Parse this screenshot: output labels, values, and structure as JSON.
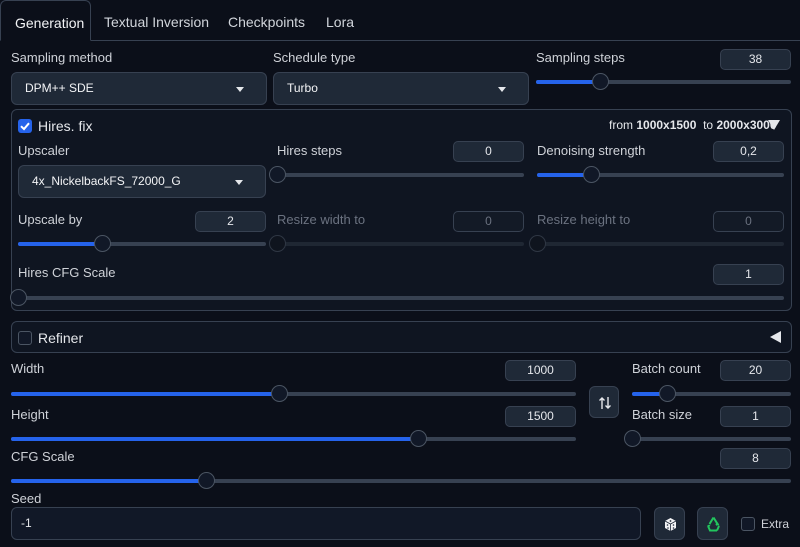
{
  "tabs": [
    "Generation",
    "Textual Inversion",
    "Checkpoints",
    "Lora"
  ],
  "sampling": {
    "method_label": "Sampling method",
    "method_value": "DPM++ SDE",
    "schedule_label": "Schedule type",
    "schedule_value": "Turbo",
    "steps_label": "Sampling steps",
    "steps_value": "38",
    "steps_fraction": 0.25
  },
  "hires": {
    "title": "Hires. fix",
    "enabled": true,
    "res_from_prefix": "from",
    "res_from": "1000x1500",
    "res_to_prefix": "to",
    "res_to": "2000x3000",
    "upscaler_label": "Upscaler",
    "upscaler_value": "4x_NickelbackFS_72000_G",
    "steps_label": "Hires steps",
    "steps_value": "0",
    "steps_fraction": 0.0,
    "denoise_label": "Denoising strength",
    "denoise_value": "0,2",
    "denoise_fraction": 0.22,
    "upscale_by_label": "Upscale by",
    "upscale_by_value": "2",
    "upscale_by_fraction": 0.34,
    "resize_w_label": "Resize width to",
    "resize_w_value": "0",
    "resize_w_fraction": 0.0,
    "resize_h_label": "Resize height to",
    "resize_h_value": "0",
    "resize_h_fraction": 0.0,
    "cfg_label": "Hires CFG Scale",
    "cfg_value": "1",
    "cfg_fraction": 0.0
  },
  "refiner": {
    "title": "Refiner",
    "enabled": false
  },
  "size": {
    "width_label": "Width",
    "width_value": "1000",
    "width_fraction": 0.474,
    "height_label": "Height",
    "height_value": "1500",
    "height_fraction": 0.72,
    "swap_icon": "swap-vertical-icon"
  },
  "batch": {
    "count_label": "Batch count",
    "count_value": "20",
    "count_fraction": 0.22,
    "size_label": "Batch size",
    "size_value": "1",
    "size_fraction": 0.0
  },
  "cfg": {
    "label": "CFG Scale",
    "value": "8",
    "fraction": 0.25
  },
  "seed": {
    "label": "Seed",
    "value": "-1",
    "extra_label": "Extra",
    "extra_enabled": false
  },
  "colors": {
    "accent": "#2563eb",
    "background": "#0b0f19",
    "recycle_green": "#22c55e"
  }
}
